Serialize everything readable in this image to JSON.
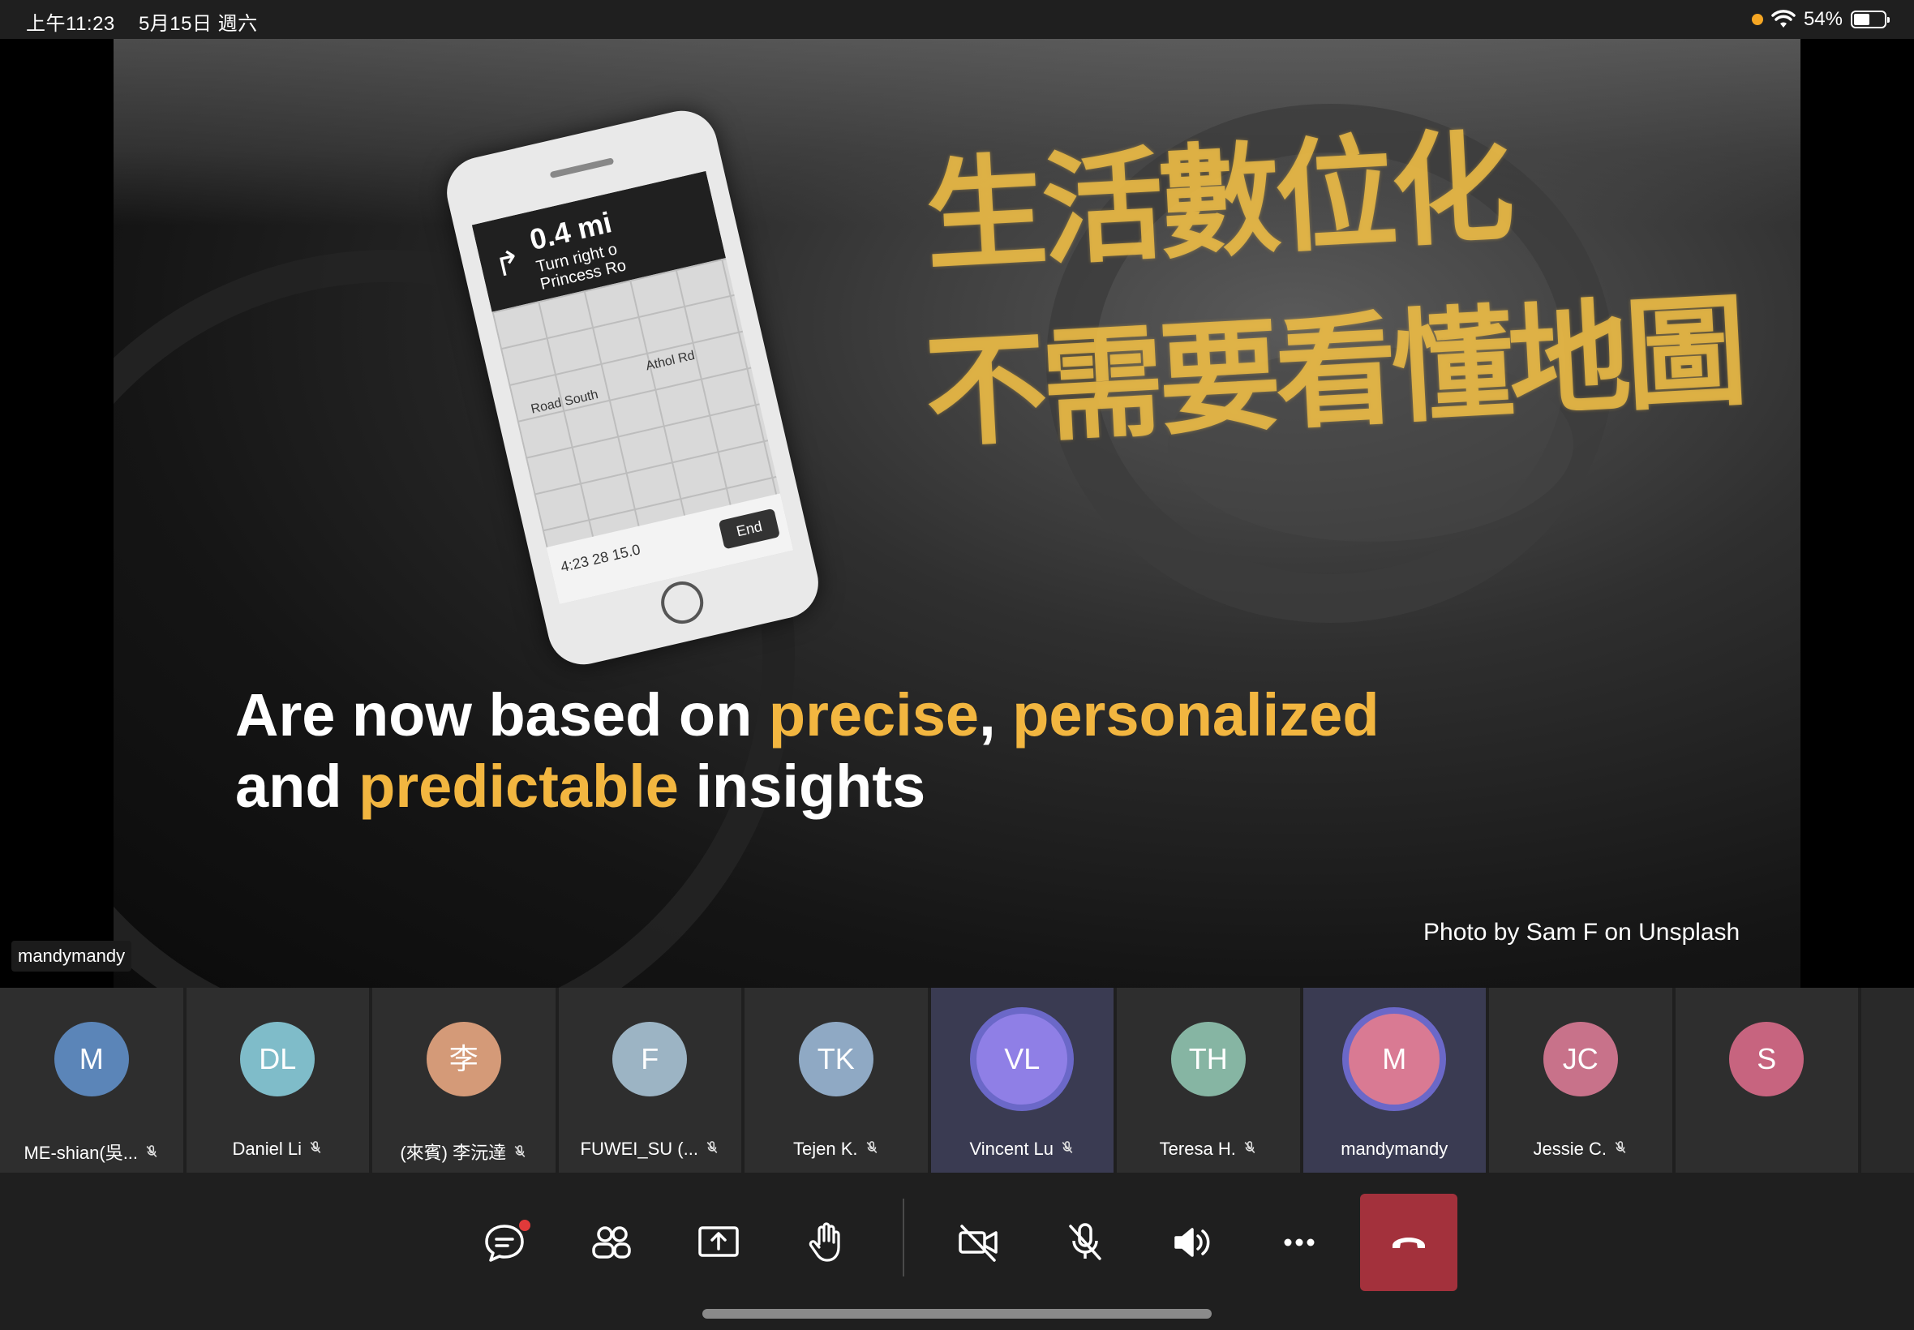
{
  "status_bar": {
    "time": "上午11:23",
    "date": "5月15日 週六",
    "battery": "54%",
    "battery_level": 0.54
  },
  "slide": {
    "phone": {
      "distance": "0.4 mi",
      "line1": "Turn right o",
      "line2": "Princess Ro",
      "road_south": "Road South",
      "athol": "Athol Rd",
      "eta": "4:23  28  15.0",
      "end": "End"
    },
    "annotation_line1": "生活數位化",
    "annotation_line2": "不需要看懂地圖",
    "text_line1_a": "Are now based on ",
    "text_line1_b": "precise",
    "text_line1_c": ", ",
    "text_line1_d": "personalized",
    "text_line2_a": "and ",
    "text_line2_b": "predictable",
    "text_line2_c": " insights",
    "credit": "Photo by Sam F on Unsplash",
    "presenter_tag": "mandymandy",
    "highlight_color": "#f2b640"
  },
  "participants": [
    {
      "initials": "M",
      "name": "ME-shian(吳...",
      "muted": true,
      "color": "#5b85b8",
      "active": false
    },
    {
      "initials": "DL",
      "name": "Daniel Li",
      "muted": true,
      "color": "#7fbcc9",
      "active": false
    },
    {
      "initials": "李",
      "name": "(來賓) 李沅達",
      "muted": true,
      "color": "#d49a78",
      "active": false
    },
    {
      "initials": "F",
      "name": "FUWEI_SU (...",
      "muted": true,
      "color": "#9cb4c4",
      "active": false
    },
    {
      "initials": "TK",
      "name": "Tejen K.",
      "muted": true,
      "color": "#8fa9c4",
      "active": false
    },
    {
      "initials": "VL",
      "name": "Vincent Lu",
      "muted": true,
      "color": "#8f7fe6",
      "active": true
    },
    {
      "initials": "TH",
      "name": "Teresa H.",
      "muted": true,
      "color": "#86b5a3",
      "active": false
    },
    {
      "initials": "M",
      "name": "mandymandy",
      "muted": false,
      "color": "#d97a93",
      "active": true
    },
    {
      "initials": "JC",
      "name": "Jessie C.",
      "muted": true,
      "color": "#c8728a",
      "active": false
    },
    {
      "initials": "S",
      "name": "",
      "muted": false,
      "color": "#c7647f",
      "active": false
    }
  ],
  "mute_icon": "mic-off-icon",
  "toolbar": {
    "chat_icon": "chat-icon",
    "people_icon": "participants-icon",
    "share_icon": "share-screen-icon",
    "raise_hand_icon": "raise-hand-icon",
    "camera_icon": "camera-off-icon",
    "mic_icon": "mic-off-icon",
    "speaker_icon": "speaker-icon",
    "more_icon": "more-icon",
    "leave_icon": "hang-up-icon",
    "leave_color": "#a3313c"
  }
}
